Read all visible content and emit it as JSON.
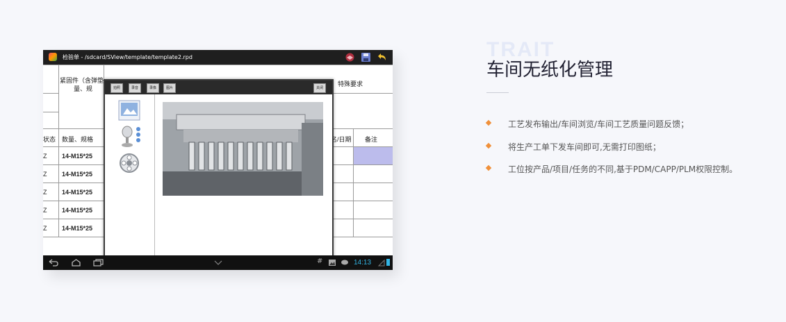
{
  "screenshot": {
    "title": "检验单 - /sdcard/SView/template/template2.rpd",
    "table": {
      "header_a": "紧固件（含弹垫",
      "header_a2": "量、规",
      "header_special": "特殊要求",
      "col_status": "状态",
      "col_qty": "数量、规格",
      "col_date": "名/日期",
      "col_note": "备注",
      "rows": [
        {
          "status": "Z",
          "qty": "14-M15*25"
        },
        {
          "status": "Z",
          "qty": "14-M15*25"
        },
        {
          "status": "Z",
          "qty": "14-M15*25"
        },
        {
          "status": "Z",
          "qty": "14-M15*25"
        },
        {
          "status": "Z",
          "qty": "14-M15*25"
        }
      ]
    },
    "dialog": {
      "buttons": [
        "拍照",
        "录音",
        "录像",
        "图片"
      ],
      "close_label": "关闭",
      "thumbnails": [
        "image-thumb-icon",
        "audio-thumb-icon",
        "video-thumb-icon"
      ]
    },
    "navbar": {
      "clock": "14:13"
    }
  },
  "content": {
    "bg_label": "TRAIT",
    "heading": "车间无纸化管理",
    "bullets": [
      "工艺发布输出/车间浏览/车间工艺质量问题反馈；",
      "将生产工单下发车间即可,无需打印图纸；",
      "工位按产品/项目/任务的不同,基于PDM/CAPP/PLM权限控制。"
    ]
  },
  "colors": {
    "accent": "#f0903a",
    "highlight_cell": "#bcbcec",
    "clock": "#33b5e5"
  }
}
